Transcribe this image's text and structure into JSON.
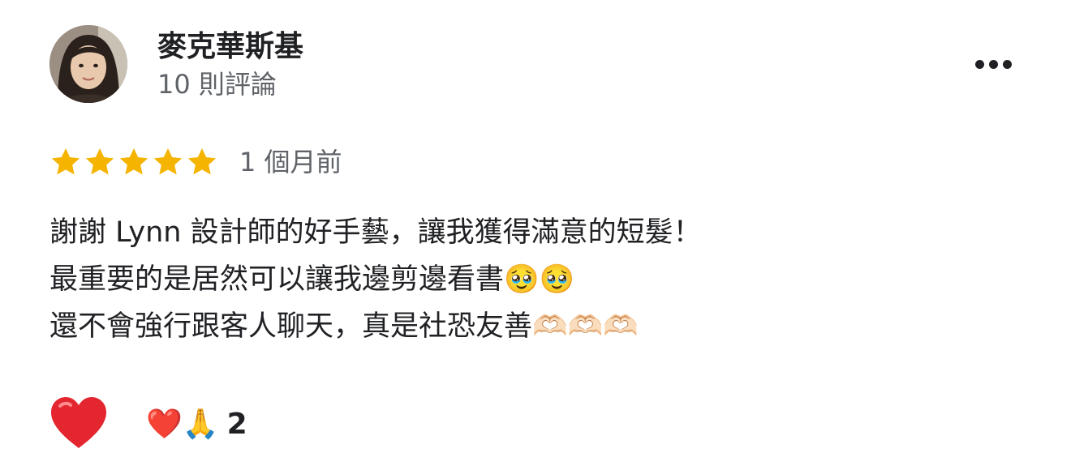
{
  "reviewer": {
    "name": "麥克華斯基",
    "review_count": "10 則評論"
  },
  "review": {
    "rating": 5,
    "rating_max": 5,
    "time": "1 個月前",
    "lines": [
      "謝謝 Lynn 設計師的好手藝，讓我獲得滿意的短髮！",
      "最重要的是居然可以讓我邊剪邊看書🥹🥹",
      "還不會強行跟客人聊天，真是社恐友善🫶🏻🫶🏻🫶🏻"
    ]
  },
  "reactions": {
    "emojis": "❤️🙏",
    "count": "2"
  },
  "colors": {
    "star": "#f5b400",
    "like_heart": "#e3262f",
    "text": "#202124",
    "secondary_text": "#5f6368"
  },
  "icons": {
    "more": "more-vert-dots-icon",
    "star": "star-icon",
    "like": "heart-icon"
  }
}
